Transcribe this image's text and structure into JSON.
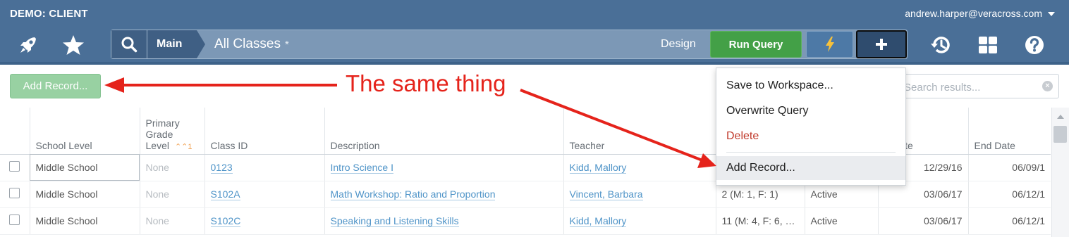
{
  "app": {
    "org_label": "DEMO: CLIENT",
    "user_email": "andrew.harper@veracross.com"
  },
  "nav": {
    "left_icons": [
      "rocket-icon",
      "star-icon"
    ],
    "right_icons": [
      "history-icon",
      "dashboard-grid-icon",
      "help-icon"
    ]
  },
  "query_bar": {
    "breadcrumb_main": "Main",
    "title": "All Classes",
    "modified_mark": "*",
    "design_label": "Design",
    "run_query_label": "Run Query",
    "run_query_color": "#43a047",
    "bolt_icon": "lightning-bolt-icon",
    "plus_icon": "plus-icon"
  },
  "toolbar": {
    "add_record_label": "Add Record...",
    "add_record_color": "#98d1a2",
    "search_placeholder": "Search results..."
  },
  "annotation": {
    "text": "The same thing",
    "color": "#e5231b"
  },
  "dropdown": {
    "items": [
      {
        "label": "Save to Workspace..."
      },
      {
        "label": "Overwrite Query"
      },
      {
        "label": "Delete"
      },
      {
        "label": "Add Record..."
      }
    ]
  },
  "table": {
    "columns": [
      {
        "label": ""
      },
      {
        "label": "School Level"
      },
      {
        "label": "Primary Grade Level",
        "lines": [
          "Primary",
          "Grade",
          "Level"
        ],
        "sort": "1"
      },
      {
        "label": "Class ID"
      },
      {
        "label": "Description"
      },
      {
        "label": "Teacher"
      },
      {
        "label": ""
      },
      {
        "label": ""
      },
      {
        "label": "Begin Date",
        "visible_text": "n Date"
      },
      {
        "label": "End Date"
      }
    ],
    "rows": [
      {
        "school_level": "Middle School",
        "grade": "None",
        "class_id": "0123",
        "description": "Intro Science I",
        "teacher": "Kidd, Mallory",
        "enrollment": "",
        "status": "",
        "begin_date": "12/29/16",
        "end_date": "06/09/1"
      },
      {
        "school_level": "Middle School",
        "grade": "None",
        "class_id": "S102A",
        "description": "Math Workshop: Ratio and Proportion",
        "teacher": "Vincent, Barbara",
        "enrollment": "2 (M: 1, F: 1)",
        "status": "Active",
        "begin_date": "03/06/17",
        "end_date": "06/12/1"
      },
      {
        "school_level": "Middle School",
        "grade": "None",
        "class_id": "S102C",
        "description": "Speaking and Listening Skills",
        "teacher": "Kidd, Mallory",
        "enrollment": "11 (M: 4, F: 6, …",
        "status": "Active",
        "begin_date": "03/06/17",
        "end_date": "06/12/1"
      }
    ]
  }
}
